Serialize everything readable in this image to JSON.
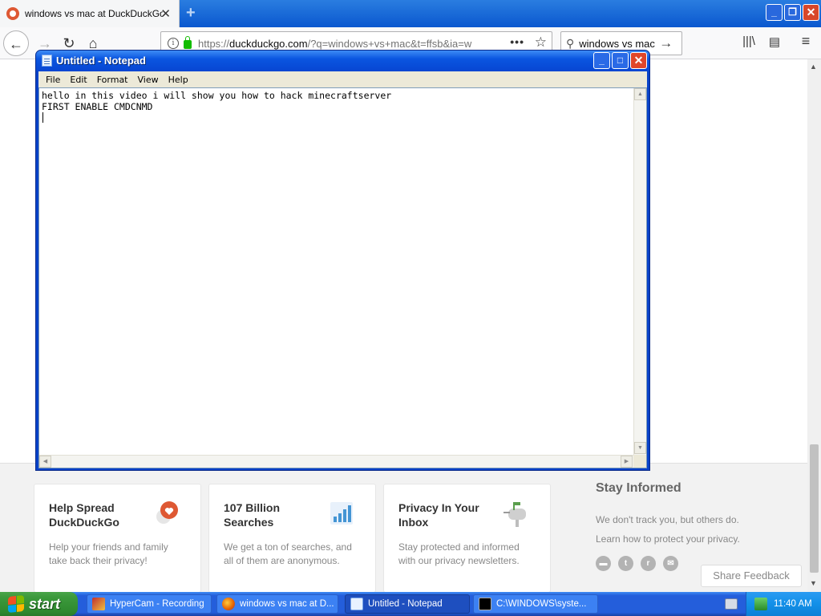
{
  "browser": {
    "tab_title": "windows vs mac at DuckDuckGo",
    "tab_close": "✕",
    "new_tab": "+",
    "url_prefix": "https://",
    "url_host": "duckduckgo.com",
    "url_rest": "/?q=windows+vs+mac&t=ffsb&ia=w",
    "search_value": "windows vs mac",
    "icons": {
      "back": "back-arrow-icon",
      "forward": "forward-arrow-icon",
      "reload": "reload-icon",
      "home": "home-icon",
      "info": "info-icon",
      "lock": "lock-icon",
      "more": "page-actions-icon",
      "bookmark": "bookmark-star-icon",
      "search": "search-icon",
      "go": "go-arrow-icon",
      "library": "library-icon",
      "sidebar": "sidebar-icon",
      "menu": "hamburger-menu-icon"
    },
    "accent_color": "#0a58cf"
  },
  "ddg": {
    "cards": [
      {
        "title": "Help Spread DuckDuckGo",
        "text": "Help your friends and family take back their privacy!"
      },
      {
        "title": "107 Billion Searches",
        "text": "We get a ton of searches, and all of them are anonymous."
      },
      {
        "title": "Privacy In Your Inbox",
        "text": "Stay protected and informed with our privacy newsletters."
      }
    ],
    "stay_informed": {
      "title": "Stay Informed",
      "line1": "We don't track you, but others do.",
      "line2": "Learn how to protect your privacy."
    },
    "social": [
      "speech-bubble-icon",
      "twitter-icon",
      "reddit-icon",
      "email-icon"
    ],
    "share_feedback": "Share Feedback"
  },
  "notepad": {
    "title": "Untitled - Notepad",
    "menu": [
      "File",
      "Edit",
      "Format",
      "View",
      "Help"
    ],
    "text": "hello in this video i will show you how to hack minecraftserver\nFIRST ENABLE CMDCNMD\n",
    "controls": {
      "minimize": "_",
      "maximize": "□",
      "close": "✕"
    }
  },
  "taskbar": {
    "start_label": "start",
    "tasks": [
      {
        "label": "HyperCam - Recording",
        "icon": "hypercam-icon",
        "active": false
      },
      {
        "label": "windows vs mac at D...",
        "icon": "firefox-icon",
        "active": false
      },
      {
        "label": "Untitled - Notepad",
        "icon": "notepad-icon",
        "active": true
      },
      {
        "label": "C:\\WINDOWS\\syste...",
        "icon": "cmd-icon",
        "active": false
      }
    ],
    "clock": "11:40 AM",
    "colors": {
      "taskbar": "#245edb",
      "start": "#3c9a3c",
      "tray": "#1290e8"
    }
  }
}
